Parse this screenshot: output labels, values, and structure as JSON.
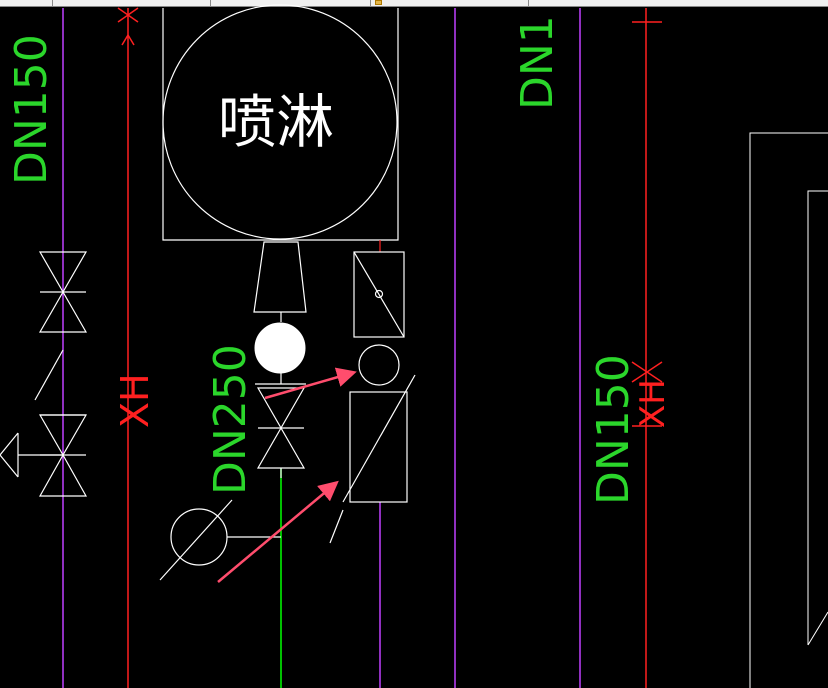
{
  "diagram": {
    "label_spray": "喷淋",
    "label_dn250": "DN250",
    "label_dn150_left": "DN150",
    "label_dn150_mid": "DN150",
    "label_dn1_top": "DN1",
    "label_xh_left": "XH",
    "label_xh_right": "XH"
  },
  "colors": {
    "background": "#000000",
    "pipe_white": "#ffffff",
    "pipe_red": "#ff2020",
    "pipe_green": "#00ff00",
    "pipe_magenta": "#c040ff",
    "text_green": "#2bd62b",
    "arrow": "#ff4d6d"
  }
}
